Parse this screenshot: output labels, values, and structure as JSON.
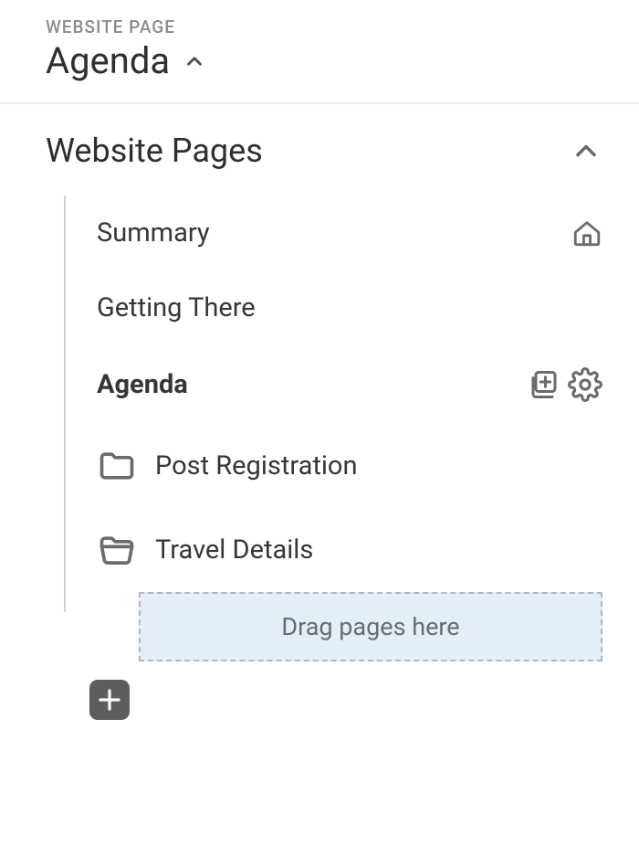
{
  "header": {
    "eyebrow": "WEBSITE PAGE",
    "title": "Agenda"
  },
  "section": {
    "title": "Website Pages"
  },
  "pages": {
    "summary": "Summary",
    "getting_there": "Getting There",
    "agenda": "Agenda",
    "post_registration": "Post Registration",
    "travel_details": "Travel Details"
  },
  "dropzone": {
    "label": "Drag pages here"
  },
  "colors": {
    "icon": "#6b6b6b",
    "line": "#d0d0d0"
  }
}
